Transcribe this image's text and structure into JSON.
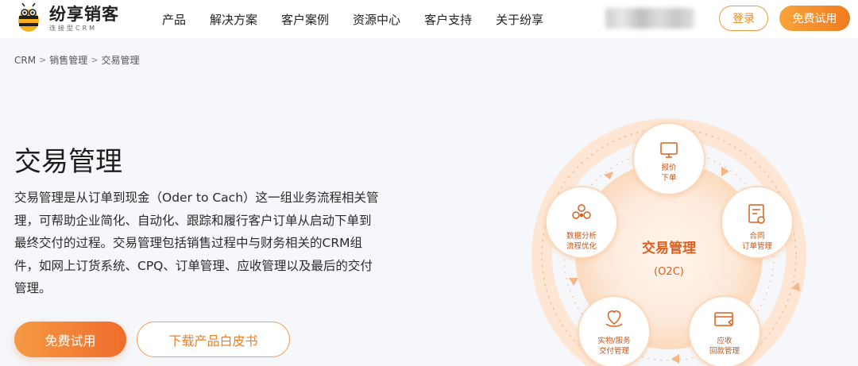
{
  "header": {
    "logo": {
      "name": "纷享销客",
      "tagline": "连接型CRM"
    },
    "nav": [
      "产品",
      "解决方案",
      "客户案例",
      "资源中心",
      "客户支持",
      "关于纷享"
    ],
    "login_label": "登录",
    "trial_label": "免费试用"
  },
  "breadcrumb": [
    "CRM",
    "销售管理",
    "交易管理"
  ],
  "hero": {
    "title": "交易管理",
    "description": "交易管理是从订单到现金（Oder to Cach）这一组业务流程相关管理，可帮助企业简化、自动化、跟踪和履行客户订单从启动下单到最终交付的过程。交易管理包括销售过程中与财务相关的CRM组件，如网上订货系统、CPQ、订单管理、应收管理以及最后的交付管理。",
    "primary_button": "免费试用",
    "secondary_button": "下载产品白皮书"
  },
  "diagram": {
    "center_title": "交易管理",
    "center_subtitle": "(O2C)",
    "nodes": [
      {
        "icon": "monitor-icon",
        "line1": "报价",
        "line2": "下单"
      },
      {
        "icon": "contract-icon",
        "line1": "合同",
        "line2": "订单管理"
      },
      {
        "icon": "receipt-icon",
        "line1": "应收",
        "line2": "回款管理"
      },
      {
        "icon": "heart-hand-icon",
        "line1": "实物/服务",
        "line2": "交付管理"
      },
      {
        "icon": "analytics-icon",
        "line1": "数据分析",
        "line2": "流程优化"
      }
    ],
    "accent": "#f08a24"
  }
}
